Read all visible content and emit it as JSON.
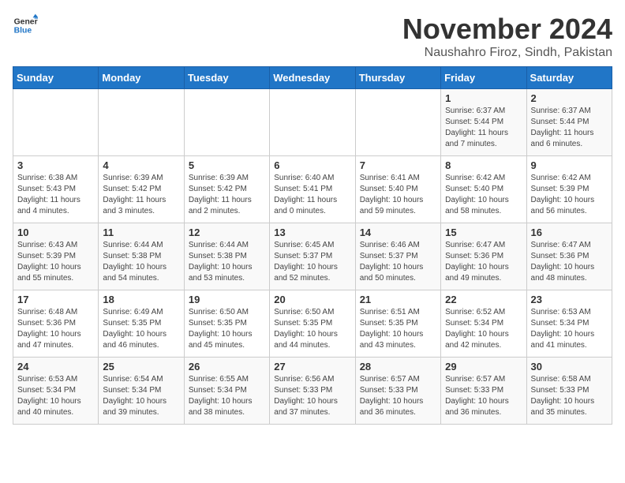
{
  "logo": {
    "line1": "General",
    "line2": "Blue"
  },
  "title": "November 2024",
  "subtitle": "Naushahro Firoz, Sindh, Pakistan",
  "weekdays": [
    "Sunday",
    "Monday",
    "Tuesday",
    "Wednesday",
    "Thursday",
    "Friday",
    "Saturday"
  ],
  "weeks": [
    [
      {
        "day": "",
        "info": ""
      },
      {
        "day": "",
        "info": ""
      },
      {
        "day": "",
        "info": ""
      },
      {
        "day": "",
        "info": ""
      },
      {
        "day": "",
        "info": ""
      },
      {
        "day": "1",
        "info": "Sunrise: 6:37 AM\nSunset: 5:44 PM\nDaylight: 11 hours and 7 minutes."
      },
      {
        "day": "2",
        "info": "Sunrise: 6:37 AM\nSunset: 5:44 PM\nDaylight: 11 hours and 6 minutes."
      }
    ],
    [
      {
        "day": "3",
        "info": "Sunrise: 6:38 AM\nSunset: 5:43 PM\nDaylight: 11 hours and 4 minutes."
      },
      {
        "day": "4",
        "info": "Sunrise: 6:39 AM\nSunset: 5:42 PM\nDaylight: 11 hours and 3 minutes."
      },
      {
        "day": "5",
        "info": "Sunrise: 6:39 AM\nSunset: 5:42 PM\nDaylight: 11 hours and 2 minutes."
      },
      {
        "day": "6",
        "info": "Sunrise: 6:40 AM\nSunset: 5:41 PM\nDaylight: 11 hours and 0 minutes."
      },
      {
        "day": "7",
        "info": "Sunrise: 6:41 AM\nSunset: 5:40 PM\nDaylight: 10 hours and 59 minutes."
      },
      {
        "day": "8",
        "info": "Sunrise: 6:42 AM\nSunset: 5:40 PM\nDaylight: 10 hours and 58 minutes."
      },
      {
        "day": "9",
        "info": "Sunrise: 6:42 AM\nSunset: 5:39 PM\nDaylight: 10 hours and 56 minutes."
      }
    ],
    [
      {
        "day": "10",
        "info": "Sunrise: 6:43 AM\nSunset: 5:39 PM\nDaylight: 10 hours and 55 minutes."
      },
      {
        "day": "11",
        "info": "Sunrise: 6:44 AM\nSunset: 5:38 PM\nDaylight: 10 hours and 54 minutes."
      },
      {
        "day": "12",
        "info": "Sunrise: 6:44 AM\nSunset: 5:38 PM\nDaylight: 10 hours and 53 minutes."
      },
      {
        "day": "13",
        "info": "Sunrise: 6:45 AM\nSunset: 5:37 PM\nDaylight: 10 hours and 52 minutes."
      },
      {
        "day": "14",
        "info": "Sunrise: 6:46 AM\nSunset: 5:37 PM\nDaylight: 10 hours and 50 minutes."
      },
      {
        "day": "15",
        "info": "Sunrise: 6:47 AM\nSunset: 5:36 PM\nDaylight: 10 hours and 49 minutes."
      },
      {
        "day": "16",
        "info": "Sunrise: 6:47 AM\nSunset: 5:36 PM\nDaylight: 10 hours and 48 minutes."
      }
    ],
    [
      {
        "day": "17",
        "info": "Sunrise: 6:48 AM\nSunset: 5:36 PM\nDaylight: 10 hours and 47 minutes."
      },
      {
        "day": "18",
        "info": "Sunrise: 6:49 AM\nSunset: 5:35 PM\nDaylight: 10 hours and 46 minutes."
      },
      {
        "day": "19",
        "info": "Sunrise: 6:50 AM\nSunset: 5:35 PM\nDaylight: 10 hours and 45 minutes."
      },
      {
        "day": "20",
        "info": "Sunrise: 6:50 AM\nSunset: 5:35 PM\nDaylight: 10 hours and 44 minutes."
      },
      {
        "day": "21",
        "info": "Sunrise: 6:51 AM\nSunset: 5:35 PM\nDaylight: 10 hours and 43 minutes."
      },
      {
        "day": "22",
        "info": "Sunrise: 6:52 AM\nSunset: 5:34 PM\nDaylight: 10 hours and 42 minutes."
      },
      {
        "day": "23",
        "info": "Sunrise: 6:53 AM\nSunset: 5:34 PM\nDaylight: 10 hours and 41 minutes."
      }
    ],
    [
      {
        "day": "24",
        "info": "Sunrise: 6:53 AM\nSunset: 5:34 PM\nDaylight: 10 hours and 40 minutes."
      },
      {
        "day": "25",
        "info": "Sunrise: 6:54 AM\nSunset: 5:34 PM\nDaylight: 10 hours and 39 minutes."
      },
      {
        "day": "26",
        "info": "Sunrise: 6:55 AM\nSunset: 5:34 PM\nDaylight: 10 hours and 38 minutes."
      },
      {
        "day": "27",
        "info": "Sunrise: 6:56 AM\nSunset: 5:33 PM\nDaylight: 10 hours and 37 minutes."
      },
      {
        "day": "28",
        "info": "Sunrise: 6:57 AM\nSunset: 5:33 PM\nDaylight: 10 hours and 36 minutes."
      },
      {
        "day": "29",
        "info": "Sunrise: 6:57 AM\nSunset: 5:33 PM\nDaylight: 10 hours and 36 minutes."
      },
      {
        "day": "30",
        "info": "Sunrise: 6:58 AM\nSunset: 5:33 PM\nDaylight: 10 hours and 35 minutes."
      }
    ]
  ]
}
